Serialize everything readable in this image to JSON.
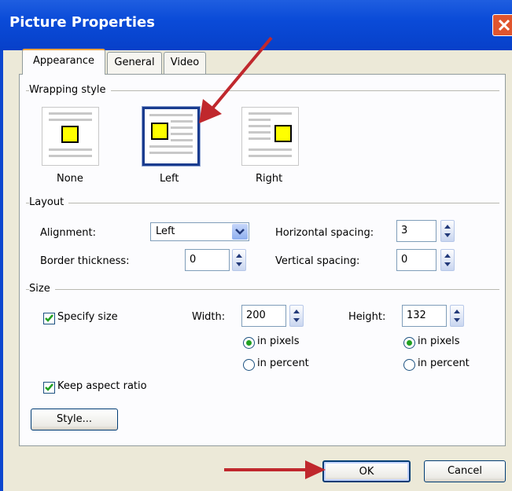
{
  "window": {
    "title": "Picture Properties",
    "close_label": "×"
  },
  "tabs": [
    {
      "label": "Appearance",
      "active": true
    },
    {
      "label": "General",
      "active": false
    },
    {
      "label": "Video",
      "active": false
    }
  ],
  "wrapping": {
    "section_label": "Wrapping style",
    "options": [
      {
        "label": "None",
        "selected": false
      },
      {
        "label": "Left",
        "selected": true
      },
      {
        "label": "Right",
        "selected": false
      }
    ]
  },
  "layout": {
    "section_label": "Layout",
    "alignment_label": "Alignment:",
    "alignment_value": "Left",
    "border_label": "Border thickness:",
    "border_value": "0",
    "hspacing_label": "Horizontal spacing:",
    "hspacing_value": "3",
    "vspacing_label": "Vertical spacing:",
    "vspacing_value": "0"
  },
  "size": {
    "section_label": "Size",
    "specify_label": "Specify size",
    "specify_checked": true,
    "width_label": "Width:",
    "width_value": "200",
    "height_label": "Height:",
    "height_value": "132",
    "in_pixels": "in pixels",
    "in_percent": "in percent",
    "width_unit": "pixels",
    "height_unit": "pixels",
    "keep_aspect_label": "Keep aspect ratio",
    "keep_aspect_checked": true,
    "style_button": "Style..."
  },
  "buttons": {
    "ok": "OK",
    "cancel": "Cancel"
  },
  "colors": {
    "annotation_arrow": "#c0282d",
    "title_bar": "#0a4bd8",
    "selection_border": "#1a3c8f"
  }
}
